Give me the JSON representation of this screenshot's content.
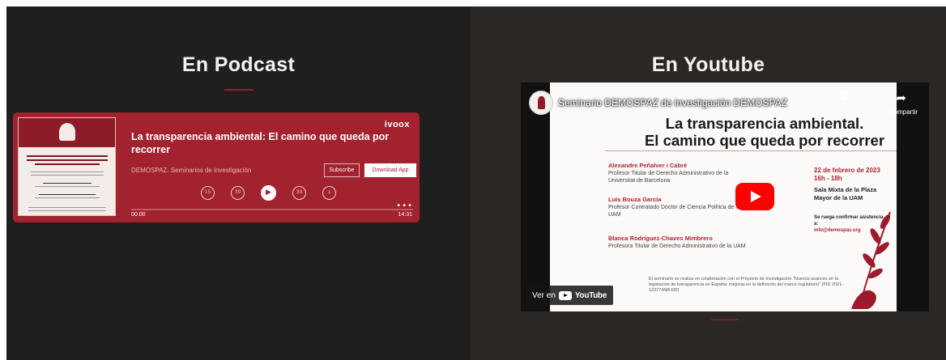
{
  "podcast_section": {
    "title": "En Podcast",
    "player": {
      "brand": "ivoox",
      "episode_title": "La transparencia ambiental: El camino que queda por recorrer",
      "author": "DEMOSPAZ. Seminarios de investigación",
      "subscribe_label": "Subscribe",
      "download_label": "Download App",
      "controls": [
        "15",
        "30",
        "play",
        "30",
        "download"
      ],
      "more_label": "•••",
      "time_elapsed": "00:00",
      "time_total": "14:31",
      "progress_fraction": 0.0,
      "accent_color": "#a2222f"
    }
  },
  "youtube_section": {
    "title": "En Youtube",
    "video": {
      "video_title": "Seminario DEMOSPAZ de investigación DEMOSPAZ",
      "share_label": "Compartir",
      "slide": {
        "headline_line1": "La transparencia ambiental.",
        "headline_line2": "El camino que queda por recorrer",
        "speakers": [
          {
            "name": "Alexandre Peñalver i Cabré",
            "role": "Profesor Titular de Derecho Administrativo de la Universitat de Barcelona"
          },
          {
            "name": "Luis Bouza García",
            "role": "Profesor Contratado Doctor de Ciencia Política de la UAM"
          },
          {
            "name": "Blanca Rodríguez-Chaves Mimbrero",
            "role": "Profesora Titular de Derecho Administrativo de la UAM"
          }
        ],
        "date_line1": "22 de febrero de 2023",
        "date_line2": "16h - 18h",
        "place": "Sala Mixta de la Plaza Mayor de la UAM",
        "note": "Se ruega confirmar asistencia a:",
        "email": "info@demospaz.org",
        "footer": "El seminario se realiza en colaboración con el Proyecto de Investigación \"Nuevos avances en la legislación de transparencia en España: mejoras en la definición del marco regulatorio\" (PID 2021-123774NB-I00)"
      },
      "watch_on_label": "Ver en",
      "youtube_word": "YouTube"
    }
  }
}
